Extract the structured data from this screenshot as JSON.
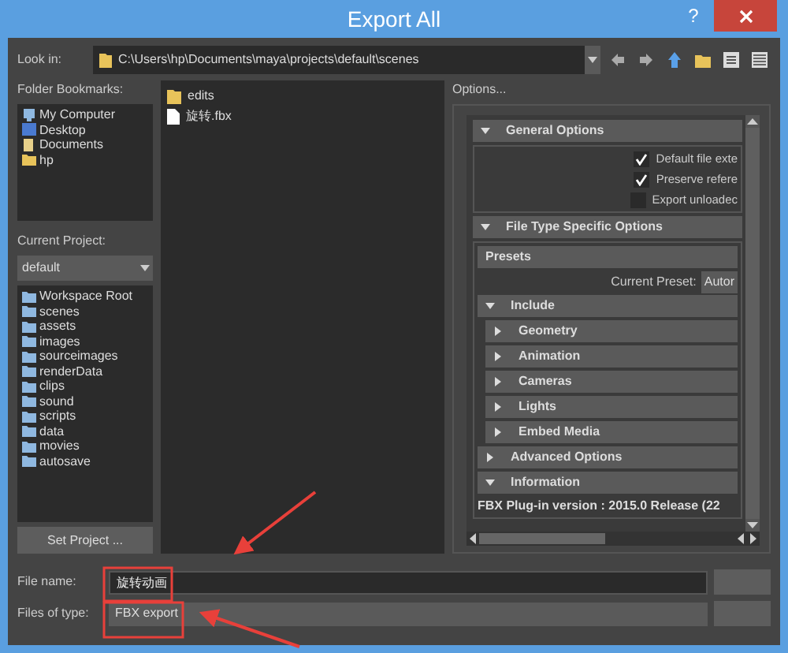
{
  "window": {
    "title": "Export All",
    "help": "?"
  },
  "look_in": {
    "label": "Look in:",
    "path": "C:\\Users\\hp\\Documents\\maya\\projects\\default\\scenes"
  },
  "bookmarks": {
    "label": "Folder Bookmarks:",
    "items": [
      {
        "label": "My Computer",
        "kind": "computer"
      },
      {
        "label": "Desktop",
        "kind": "desktop"
      },
      {
        "label": "Documents",
        "kind": "document"
      },
      {
        "label": "hp",
        "kind": "folder"
      }
    ]
  },
  "project": {
    "label": "Current Project:",
    "value": "default",
    "button": "Set Project ...",
    "folders": [
      "Workspace Root",
      "scenes",
      "assets",
      "images",
      "sourceimages",
      "renderData",
      "clips",
      "sound",
      "scripts",
      "data",
      "movies",
      "autosave"
    ]
  },
  "files": [
    {
      "name": "edits",
      "kind": "folder"
    },
    {
      "name": "旋转.fbx",
      "kind": "file"
    }
  ],
  "options": {
    "label": "Options...",
    "sections": [
      {
        "title": "General Options",
        "expanded": true,
        "checkboxes": [
          {
            "label": "Default file exte",
            "checked": true
          },
          {
            "label": "Preserve refere",
            "checked": true
          },
          {
            "label": "Export unloadec",
            "checked": false
          }
        ]
      },
      {
        "title": "File Type Specific Options",
        "expanded": true,
        "children": [
          {
            "title": "Presets",
            "kind": "header",
            "preset_label": "Current Preset:",
            "preset_value": "Autor"
          },
          {
            "title": "Include",
            "kind": "group",
            "expanded": true,
            "children": [
              {
                "title": "Geometry",
                "expanded": false
              },
              {
                "title": "Animation",
                "expanded": false
              },
              {
                "title": "Cameras",
                "expanded": false
              },
              {
                "title": "Lights",
                "expanded": false
              },
              {
                "title": "Embed Media",
                "expanded": false
              }
            ]
          },
          {
            "title": "Advanced Options",
            "kind": "group",
            "expanded": false
          },
          {
            "title": "Information",
            "kind": "group",
            "expanded": true,
            "info": "FBX Plug-in version :  2015.0 Release (22"
          }
        ]
      }
    ]
  },
  "file_name": {
    "label": "File name:",
    "value": "旋转动画"
  },
  "file_type": {
    "label": "Files of type:",
    "value": "FBX export"
  }
}
